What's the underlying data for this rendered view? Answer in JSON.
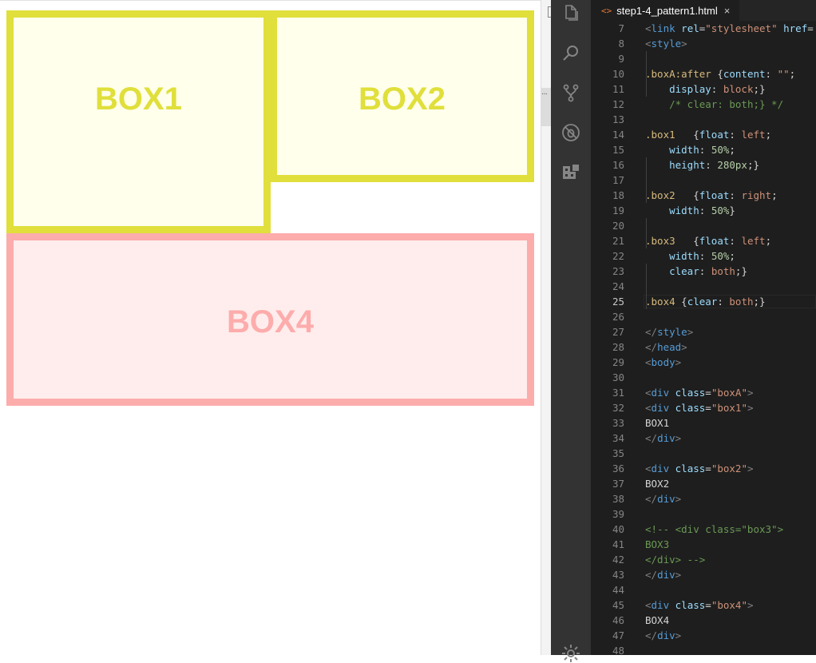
{
  "preview": {
    "box1_label": "BOX1",
    "box2_label": "BOX2",
    "box4_label": "BOX4"
  },
  "colors": {
    "yellow_border": "#e0df3b",
    "yellow_bg": "#ffffeb",
    "pink_border": "#fdacac",
    "pink_bg": "#ffeded",
    "editor_bg": "#1e1e1e",
    "activity_bg": "#333333"
  },
  "activity_bar": {
    "icons": [
      "explorer-icon",
      "search-icon",
      "source-control-icon",
      "debug-icon",
      "extensions-icon",
      "settings-gear-icon"
    ]
  },
  "editor": {
    "tab_icon": "<>",
    "tab_title": "step1-4_pattern1.html",
    "tab_close": "×",
    "active_line": 25,
    "lines": [
      {
        "n": "7",
        "tokens": [
          [
            "t-punc",
            "<"
          ],
          [
            "t-tag",
            "link"
          ],
          [
            "t-plain",
            " "
          ],
          [
            "t-attr",
            "rel"
          ],
          [
            "t-plain",
            "="
          ],
          [
            "t-str",
            "\"stylesheet\""
          ],
          [
            "t-plain",
            " "
          ],
          [
            "t-attr",
            "href"
          ],
          [
            "t-plain",
            "="
          ]
        ]
      },
      {
        "n": "8",
        "tokens": [
          [
            "t-punc",
            "<"
          ],
          [
            "t-tag",
            "style"
          ],
          [
            "t-punc",
            ">"
          ]
        ]
      },
      {
        "n": "9",
        "tokens": []
      },
      {
        "n": "10",
        "tokens": [
          [
            "t-sel",
            ".boxA:after"
          ],
          [
            "t-plain",
            " {"
          ],
          [
            "t-prop",
            "content"
          ],
          [
            "t-plain",
            ": "
          ],
          [
            "t-str",
            "\"\""
          ],
          [
            "t-plain",
            ";"
          ]
        ]
      },
      {
        "n": "11",
        "tokens": [
          [
            "t-plain",
            "    "
          ],
          [
            "t-prop",
            "display"
          ],
          [
            "t-plain",
            ": "
          ],
          [
            "t-val",
            "block"
          ],
          [
            "t-plain",
            ";}"
          ]
        ]
      },
      {
        "n": "12",
        "tokens": [
          [
            "t-plain",
            "    "
          ],
          [
            "t-com",
            "/* clear: both;} */"
          ]
        ]
      },
      {
        "n": "13",
        "tokens": []
      },
      {
        "n": "14",
        "tokens": [
          [
            "t-sel",
            ".box1"
          ],
          [
            "t-plain",
            "   {"
          ],
          [
            "t-prop",
            "float"
          ],
          [
            "t-plain",
            ": "
          ],
          [
            "t-val",
            "left"
          ],
          [
            "t-plain",
            ";"
          ]
        ]
      },
      {
        "n": "15",
        "tokens": [
          [
            "t-plain",
            "    "
          ],
          [
            "t-prop",
            "width"
          ],
          [
            "t-plain",
            ": "
          ],
          [
            "t-num",
            "50%"
          ],
          [
            "t-plain",
            ";"
          ]
        ]
      },
      {
        "n": "16",
        "tokens": [
          [
            "t-plain",
            "    "
          ],
          [
            "t-prop",
            "height"
          ],
          [
            "t-plain",
            ": "
          ],
          [
            "t-num",
            "280px"
          ],
          [
            "t-plain",
            ";}"
          ]
        ]
      },
      {
        "n": "17",
        "tokens": []
      },
      {
        "n": "18",
        "tokens": [
          [
            "t-sel",
            ".box2"
          ],
          [
            "t-plain",
            "   {"
          ],
          [
            "t-prop",
            "float"
          ],
          [
            "t-plain",
            ": "
          ],
          [
            "t-val",
            "right"
          ],
          [
            "t-plain",
            ";"
          ]
        ]
      },
      {
        "n": "19",
        "tokens": [
          [
            "t-plain",
            "    "
          ],
          [
            "t-prop",
            "width"
          ],
          [
            "t-plain",
            ": "
          ],
          [
            "t-num",
            "50%"
          ],
          [
            "t-plain",
            "}"
          ]
        ]
      },
      {
        "n": "20",
        "tokens": []
      },
      {
        "n": "21",
        "tokens": [
          [
            "t-sel",
            ".box3"
          ],
          [
            "t-plain",
            "   {"
          ],
          [
            "t-prop",
            "float"
          ],
          [
            "t-plain",
            ": "
          ],
          [
            "t-val",
            "left"
          ],
          [
            "t-plain",
            ";"
          ]
        ]
      },
      {
        "n": "22",
        "tokens": [
          [
            "t-plain",
            "    "
          ],
          [
            "t-prop",
            "width"
          ],
          [
            "t-plain",
            ": "
          ],
          [
            "t-num",
            "50%"
          ],
          [
            "t-plain",
            ";"
          ]
        ]
      },
      {
        "n": "23",
        "tokens": [
          [
            "t-plain",
            "    "
          ],
          [
            "t-prop",
            "clear"
          ],
          [
            "t-plain",
            ": "
          ],
          [
            "t-val",
            "both"
          ],
          [
            "t-plain",
            ";}"
          ]
        ]
      },
      {
        "n": "24",
        "tokens": []
      },
      {
        "n": "25",
        "tokens": [
          [
            "t-sel",
            ".box4"
          ],
          [
            "t-plain",
            " {"
          ],
          [
            "t-prop",
            "clear"
          ],
          [
            "t-plain",
            ": "
          ],
          [
            "t-val",
            "both"
          ],
          [
            "t-plain",
            ";}"
          ]
        ]
      },
      {
        "n": "26",
        "tokens": []
      },
      {
        "n": "27",
        "tokens": [
          [
            "t-punc",
            "</"
          ],
          [
            "t-tag",
            "style"
          ],
          [
            "t-punc",
            ">"
          ]
        ]
      },
      {
        "n": "28",
        "tokens": [
          [
            "t-punc",
            "</"
          ],
          [
            "t-tag",
            "head"
          ],
          [
            "t-punc",
            ">"
          ]
        ]
      },
      {
        "n": "29",
        "tokens": [
          [
            "t-punc",
            "<"
          ],
          [
            "t-tag",
            "body"
          ],
          [
            "t-punc",
            ">"
          ]
        ]
      },
      {
        "n": "30",
        "tokens": []
      },
      {
        "n": "31",
        "tokens": [
          [
            "t-punc",
            "<"
          ],
          [
            "t-tag",
            "div"
          ],
          [
            "t-plain",
            " "
          ],
          [
            "t-attr",
            "class"
          ],
          [
            "t-plain",
            "="
          ],
          [
            "t-str",
            "\"boxA\""
          ],
          [
            "t-punc",
            ">"
          ]
        ]
      },
      {
        "n": "32",
        "tokens": [
          [
            "t-punc",
            "<"
          ],
          [
            "t-tag",
            "div"
          ],
          [
            "t-plain",
            " "
          ],
          [
            "t-attr",
            "class"
          ],
          [
            "t-plain",
            "="
          ],
          [
            "t-str",
            "\"box1\""
          ],
          [
            "t-punc",
            ">"
          ]
        ]
      },
      {
        "n": "33",
        "tokens": [
          [
            "t-plain",
            "BOX1"
          ]
        ]
      },
      {
        "n": "34",
        "tokens": [
          [
            "t-punc",
            "</"
          ],
          [
            "t-tag",
            "div"
          ],
          [
            "t-punc",
            ">"
          ]
        ]
      },
      {
        "n": "35",
        "tokens": []
      },
      {
        "n": "36",
        "tokens": [
          [
            "t-punc",
            "<"
          ],
          [
            "t-tag",
            "div"
          ],
          [
            "t-plain",
            " "
          ],
          [
            "t-attr",
            "class"
          ],
          [
            "t-plain",
            "="
          ],
          [
            "t-str",
            "\"box2\""
          ],
          [
            "t-punc",
            ">"
          ]
        ]
      },
      {
        "n": "37",
        "tokens": [
          [
            "t-plain",
            "BOX2"
          ]
        ]
      },
      {
        "n": "38",
        "tokens": [
          [
            "t-punc",
            "</"
          ],
          [
            "t-tag",
            "div"
          ],
          [
            "t-punc",
            ">"
          ]
        ]
      },
      {
        "n": "39",
        "tokens": []
      },
      {
        "n": "40",
        "tokens": [
          [
            "t-com",
            "<!-- <div class=\"box3\">"
          ]
        ]
      },
      {
        "n": "41",
        "tokens": [
          [
            "t-com",
            "BOX3"
          ]
        ]
      },
      {
        "n": "42",
        "tokens": [
          [
            "t-com",
            "</div> -->"
          ]
        ]
      },
      {
        "n": "43",
        "tokens": [
          [
            "t-punc",
            "</"
          ],
          [
            "t-tag",
            "div"
          ],
          [
            "t-punc",
            ">"
          ]
        ]
      },
      {
        "n": "44",
        "tokens": []
      },
      {
        "n": "45",
        "tokens": [
          [
            "t-punc",
            "<"
          ],
          [
            "t-tag",
            "div"
          ],
          [
            "t-plain",
            " "
          ],
          [
            "t-attr",
            "class"
          ],
          [
            "t-plain",
            "="
          ],
          [
            "t-str",
            "\"box4\""
          ],
          [
            "t-punc",
            ">"
          ]
        ]
      },
      {
        "n": "46",
        "tokens": [
          [
            "t-plain",
            "BOX4"
          ]
        ]
      },
      {
        "n": "47",
        "tokens": [
          [
            "t-punc",
            "</"
          ],
          [
            "t-tag",
            "div"
          ],
          [
            "t-punc",
            ">"
          ]
        ]
      },
      {
        "n": "48",
        "tokens": []
      }
    ]
  }
}
